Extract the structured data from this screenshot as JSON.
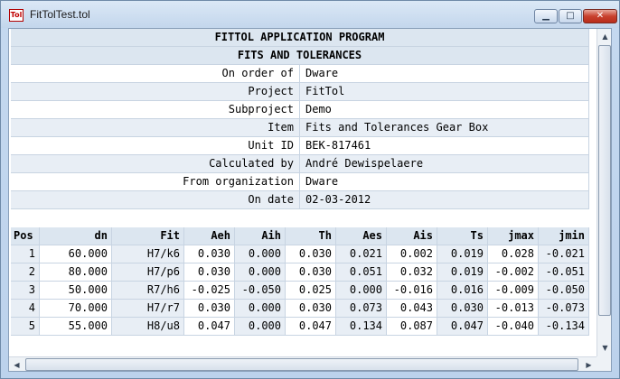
{
  "window": {
    "title": "FitTolTest.tol",
    "icon_label": "Tol",
    "minimize_glyph": "▁",
    "maximize_glyph": "□",
    "close_glyph": "✕"
  },
  "report": {
    "title": "FITTOL APPLICATION PROGRAM",
    "subtitle": "FITS AND TOLERANCES",
    "fields": [
      {
        "label": "On order of",
        "value": "Dware"
      },
      {
        "label": "Project",
        "value": "FitTol"
      },
      {
        "label": "Subproject",
        "value": "Demo"
      },
      {
        "label": "Item",
        "value": "Fits and Tolerances Gear Box"
      },
      {
        "label": "Unit ID",
        "value": "BEK-817461"
      },
      {
        "label": "Calculated by",
        "value": "André Dewispelaere"
      },
      {
        "label": "From organization",
        "value": "Dware"
      },
      {
        "label": "On date",
        "value": "02-03-2012"
      }
    ]
  },
  "table": {
    "columns": [
      "Pos",
      "dn",
      "Fit",
      "Aeh",
      "Aih",
      "Th",
      "Aes",
      "Ais",
      "Ts",
      "jmax",
      "jmin"
    ],
    "rows": [
      [
        "1",
        "60.000",
        "H7/k6",
        "0.030",
        "0.000",
        "0.030",
        "0.021",
        "0.002",
        "0.019",
        "0.028",
        "-0.021"
      ],
      [
        "2",
        "80.000",
        "H7/p6",
        "0.030",
        "0.000",
        "0.030",
        "0.051",
        "0.032",
        "0.019",
        "-0.002",
        "-0.051"
      ],
      [
        "3",
        "50.000",
        "R7/h6",
        "-0.025",
        "-0.050",
        "0.025",
        "0.000",
        "-0.016",
        "0.016",
        "-0.009",
        "-0.050"
      ],
      [
        "4",
        "70.000",
        "H7/r7",
        "0.030",
        "0.000",
        "0.030",
        "0.073",
        "0.043",
        "0.030",
        "-0.013",
        "-0.073"
      ],
      [
        "5",
        "55.000",
        "H8/u8",
        "0.047",
        "0.000",
        "0.047",
        "0.134",
        "0.087",
        "0.047",
        "-0.040",
        "-0.134"
      ]
    ]
  },
  "scrollbars": {
    "up": "▲",
    "down": "▼",
    "left": "◀",
    "right": "▶"
  }
}
